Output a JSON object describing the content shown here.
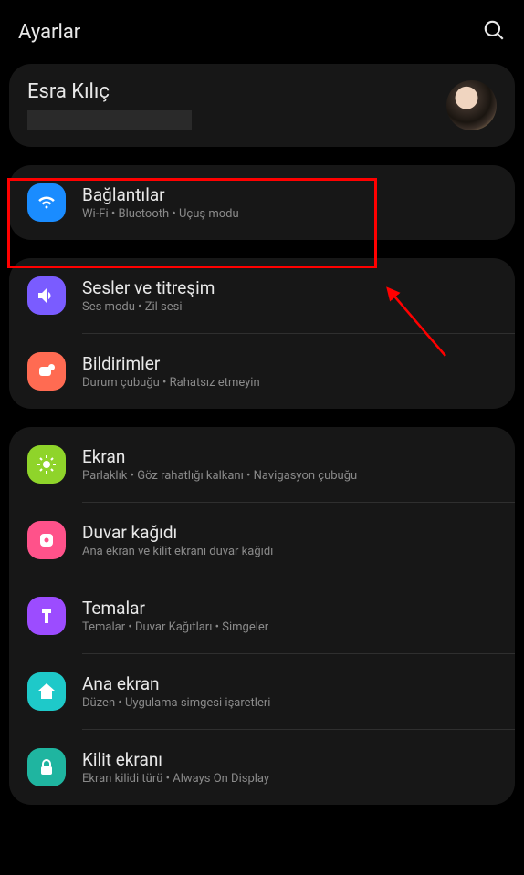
{
  "header": {
    "title": "Ayarlar"
  },
  "profile": {
    "name": "Esra Kılıç"
  },
  "sections": [
    {
      "rows": [
        {
          "title": "Bağlantılar",
          "subtitle": "Wi-Fi  •  Bluetooth  •  Uçuş modu"
        }
      ]
    },
    {
      "rows": [
        {
          "title": "Sesler ve titreşim",
          "subtitle": "Ses modu  •  Zil sesi"
        },
        {
          "title": "Bildirimler",
          "subtitle": "Durum çubuğu  •  Rahatsız etmeyin"
        }
      ]
    },
    {
      "rows": [
        {
          "title": "Ekran",
          "subtitle": "Parlaklık  •  Göz rahatlığı kalkanı  •  Navigasyon çubuğu"
        },
        {
          "title": "Duvar kağıdı",
          "subtitle": "Ana ekran ve kilit ekranı duvar kağıdı"
        },
        {
          "title": "Temalar",
          "subtitle": "Temalar  •  Duvar Kağıtları  •  Simgeler"
        },
        {
          "title": "Ana ekran",
          "subtitle": "Düzen  •  Uygulama simgesi işaretleri"
        },
        {
          "title": "Kilit ekranı",
          "subtitle": "Ekran kilidi türü  •  Always On Display"
        }
      ]
    }
  ]
}
